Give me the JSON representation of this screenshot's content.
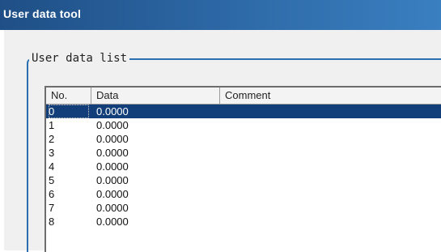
{
  "window": {
    "title": "User data tool"
  },
  "group": {
    "title": "User data list"
  },
  "table": {
    "columns": [
      "No.",
      "Data",
      "Comment"
    ],
    "rows": [
      {
        "no": "0",
        "data": "0.0000",
        "comment": "",
        "selected": true
      },
      {
        "no": "1",
        "data": "0.0000",
        "comment": ""
      },
      {
        "no": "2",
        "data": "0.0000",
        "comment": ""
      },
      {
        "no": "3",
        "data": "0.0000",
        "comment": ""
      },
      {
        "no": "4",
        "data": "0.0000",
        "comment": ""
      },
      {
        "no": "5",
        "data": "0.0000",
        "comment": ""
      },
      {
        "no": "6",
        "data": "0.0000",
        "comment": ""
      },
      {
        "no": "7",
        "data": "0.0000",
        "comment": ""
      },
      {
        "no": "8",
        "data": "0.0000",
        "comment": ""
      }
    ]
  },
  "colors": {
    "titlebar": "#1f4f86",
    "selection": "#123f7a",
    "group_border": "#2a6fb0"
  }
}
